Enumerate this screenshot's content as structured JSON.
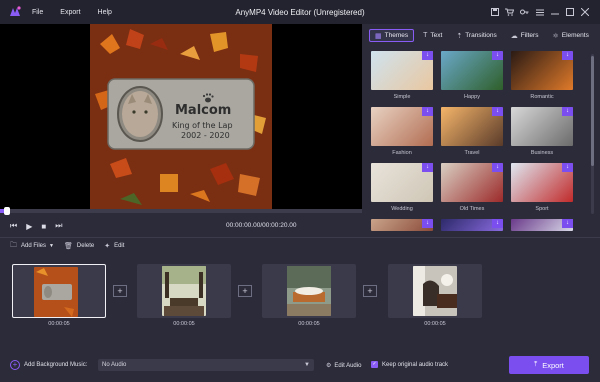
{
  "app": {
    "title": "AnyMP4 Video Editor (Unregistered)",
    "menu": [
      "File",
      "Export",
      "Help"
    ]
  },
  "preview": {
    "name_text": "Malcom",
    "subtitle_text": "King of the Lap",
    "years_text": "2002 - 2020",
    "timecode": "00:00:00.00/00:00:20.00",
    "playback_progress": 0.02
  },
  "tabs": [
    {
      "label": "Themes",
      "icon": "themes-icon"
    },
    {
      "label": "Text",
      "icon": "text-icon"
    },
    {
      "label": "Transitions",
      "icon": "transitions-icon"
    },
    {
      "label": "Filters",
      "icon": "filters-icon"
    },
    {
      "label": "Elements",
      "icon": "elements-icon"
    }
  ],
  "themes": [
    {
      "label": "Simple",
      "color_a": "#cfe3ef",
      "color_b": "#e9c7a0"
    },
    {
      "label": "Happy",
      "color_a": "#6aa8c9",
      "color_b": "#2f5f2a"
    },
    {
      "label": "Romantic",
      "color_a": "#2a1a14",
      "color_b": "#e07a2a"
    },
    {
      "label": "Fashion",
      "color_a": "#e8d2c2",
      "color_b": "#b26d52"
    },
    {
      "label": "Travel",
      "color_a": "#f5b56a",
      "color_b": "#5a3b2a"
    },
    {
      "label": "Business",
      "color_a": "#d8d8d8",
      "color_b": "#6b6b6b"
    },
    {
      "label": "Wedding",
      "color_a": "#e8e3db",
      "color_b": "#cfc6b5"
    },
    {
      "label": "Old Times",
      "color_a": "#d9d0c3",
      "color_b": "#9c2a2a"
    },
    {
      "label": "Sport",
      "color_a": "#dfe8f2",
      "color_b": "#c12a2a"
    },
    {
      "label": "",
      "color_a": "#c9a48a",
      "color_b": "#8a4a3a"
    },
    {
      "label": "",
      "color_a": "#2d2a6a",
      "color_b": "#8a6be0"
    },
    {
      "label": "",
      "color_a": "#6a3a8a",
      "color_b": "#d9d9e8"
    }
  ],
  "toolbar": {
    "add_files": "Add Files",
    "delete": "Delete",
    "edit": "Edit"
  },
  "clips": [
    {
      "time": "00:00:05",
      "kind": "cat-memorial"
    },
    {
      "time": "00:00:05",
      "kind": "chapel"
    },
    {
      "time": "00:00:05",
      "kind": "casket-flowers"
    },
    {
      "time": "00:00:05",
      "kind": "mourning"
    }
  ],
  "bottom": {
    "add_music": "Add Background Music:",
    "audio_value": "No Audio",
    "edit_audio": "Edit Audio",
    "keep_audio": "Keep original audio track",
    "export": "Export"
  },
  "colors": {
    "accent": "#7b4ef0",
    "background": "#2b2b3a",
    "titlebar": "#23232f"
  }
}
